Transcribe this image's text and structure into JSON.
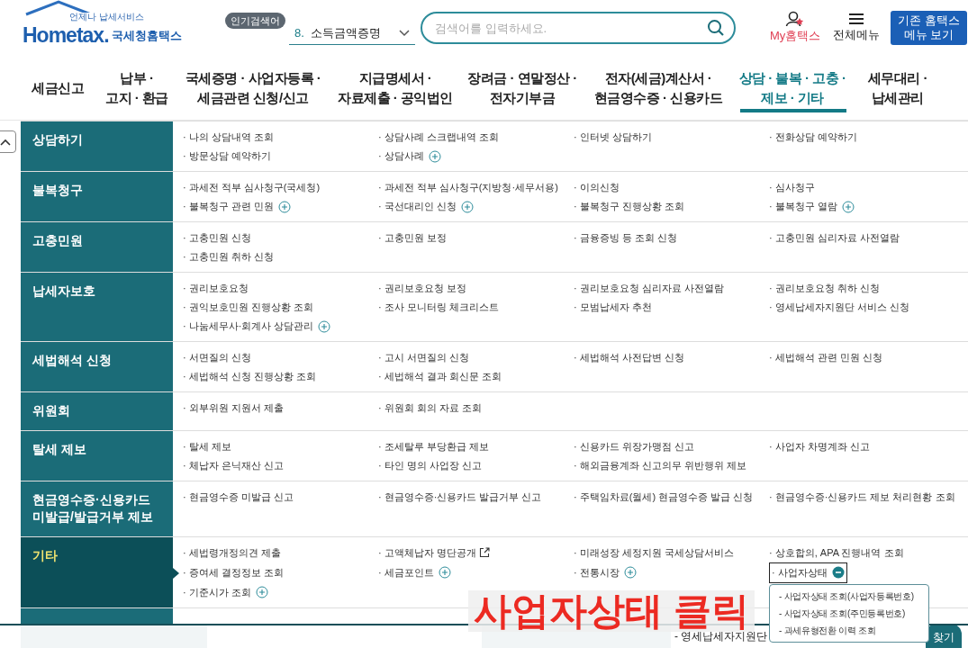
{
  "header": {
    "logo": {
      "tagline": "언제나 납세서비스",
      "wordmark": "Hometax.",
      "title": "국세청홈택스"
    },
    "popular": {
      "badge": "인기검색어",
      "rank": "8.",
      "keyword": "소득금액증명"
    },
    "search": {
      "placeholder": "검색어를 입력하세요."
    },
    "my_hometax": "My홈택스",
    "all_menu": "전체메뉴",
    "legacy_button": "기존 홈택스\n메뉴 보기"
  },
  "nav": [
    {
      "label": "세금신고",
      "selected": false
    },
    {
      "label": "납부 ·\n고지 · 환급",
      "selected": false
    },
    {
      "label": "국세증명 · 사업자등록 ·\n세금관련 신청/신고",
      "selected": false
    },
    {
      "label": "지급명세서 ·\n자료제출 · 공익법인",
      "selected": false
    },
    {
      "label": "장려금 · 연말정산 ·\n전자기부금",
      "selected": false
    },
    {
      "label": "전자(세금)계산서 ·\n현금영수증 · 신용카드",
      "selected": false
    },
    {
      "label": "상담 · 불복 · 고충 ·\n제보 · 기타",
      "selected": true
    },
    {
      "label": "세무대리 ·\n납세관리",
      "selected": false
    }
  ],
  "categories": [
    {
      "title": "상담하기",
      "selected": false,
      "items": [
        {
          "kind": "link",
          "text": "· 나의 상담내역 조회"
        },
        {
          "kind": "link",
          "text": "· 상담사례 스크랩내역 조회"
        },
        {
          "kind": "link",
          "text": "· 인터넷 상담하기"
        },
        {
          "kind": "link",
          "text": "· 전화상담 예약하기"
        },
        {
          "kind": "link",
          "text": "· 방문상담 예약하기"
        },
        {
          "kind": "toggle",
          "text": "· 상담사례",
          "expanded": false
        }
      ]
    },
    {
      "title": "불복청구",
      "selected": false,
      "items": [
        {
          "kind": "link",
          "text": "· 과세전 적부 심사청구(국세청)"
        },
        {
          "kind": "link",
          "text": "· 과세전 적부 심사청구(지방청·세무서용)"
        },
        {
          "kind": "link",
          "text": "· 이의신청"
        },
        {
          "kind": "link",
          "text": "· 심사청구"
        },
        {
          "kind": "toggle",
          "text": "· 불복청구 관련 민원",
          "expanded": false
        },
        {
          "kind": "toggle",
          "text": "· 국선대리인 신청",
          "expanded": false
        },
        {
          "kind": "link",
          "text": "· 불복청구 진행상황 조회"
        },
        {
          "kind": "toggle",
          "text": "· 불복청구 열람",
          "expanded": false
        }
      ]
    },
    {
      "title": "고충민원",
      "selected": false,
      "items": [
        {
          "kind": "link",
          "text": "· 고충민원 신청"
        },
        {
          "kind": "link",
          "text": "· 고충민원 보정"
        },
        {
          "kind": "link",
          "text": "· 금융증빙 등 조회 신청"
        },
        {
          "kind": "link",
          "text": "· 고충민원 심리자료 사전열람"
        },
        {
          "kind": "link",
          "text": "· 고충민원 취하 신청"
        }
      ]
    },
    {
      "title": "납세자보호",
      "selected": false,
      "items": [
        {
          "kind": "link",
          "text": "· 권리보호요청"
        },
        {
          "kind": "link",
          "text": "· 권리보호요청 보정"
        },
        {
          "kind": "link",
          "text": "· 권리보호요청 심리자료 사전열람"
        },
        {
          "kind": "link",
          "text": "· 권리보호요청 취하 신청"
        },
        {
          "kind": "link",
          "text": "· 권익보호민원 진행상황 조회"
        },
        {
          "kind": "link",
          "text": "· 조사 모니터링 체크리스트"
        },
        {
          "kind": "link",
          "text": "· 모범납세자 추천"
        },
        {
          "kind": "link",
          "text": "· 영세납세자지원단 서비스 신청"
        },
        {
          "kind": "toggle",
          "text": "· 나눔세무사·회계사 상담관리",
          "expanded": false
        }
      ]
    },
    {
      "title": "세법해석 신청",
      "selected": false,
      "items": [
        {
          "kind": "link",
          "text": "· 서면질의 신청"
        },
        {
          "kind": "link",
          "text": "· 고시 서면질의 신청"
        },
        {
          "kind": "link",
          "text": "· 세법해석 사전답변 신청"
        },
        {
          "kind": "link",
          "text": "· 세법해석 관련 민원 신청"
        },
        {
          "kind": "link",
          "text": "· 세법해석 신청 진행상황 조회"
        },
        {
          "kind": "link",
          "text": "· 세법해석 결과 회신문 조회"
        }
      ]
    },
    {
      "title": "위원회",
      "selected": false,
      "items": [
        {
          "kind": "link",
          "text": "· 외부위원 지원서 제출"
        },
        {
          "kind": "link",
          "text": "· 위원회 회의 자료 조회"
        }
      ]
    },
    {
      "title": "탈세 제보",
      "selected": false,
      "items": [
        {
          "kind": "link",
          "text": "· 탈세 제보"
        },
        {
          "kind": "link",
          "text": "· 조세탈루 부당환급 제보"
        },
        {
          "kind": "link",
          "text": "· 신용카드 위장가맹점 신고"
        },
        {
          "kind": "link",
          "text": "· 사업자 차명계좌 신고"
        },
        {
          "kind": "link",
          "text": "· 체납자 은닉재산 신고"
        },
        {
          "kind": "link",
          "text": "· 타인 명의 사업장 신고"
        },
        {
          "kind": "link",
          "text": "· 해외금융계좌 신고의무 위반행위 제보"
        }
      ]
    },
    {
      "title": "현금영수증·신용카드\n미발급/발급거부 제보",
      "selected": false,
      "items": [
        {
          "kind": "link",
          "text": "· 현금영수증 미발급 신고"
        },
        {
          "kind": "link",
          "text": "· 현금영수증·신용카드 발급거부 신고"
        },
        {
          "kind": "link",
          "text": "· 주택임차료(월세) 현금영수증 발급 신청"
        },
        {
          "kind": "link",
          "text": "· 현금영수증·신용카드 제보 처리현황 조회"
        }
      ]
    },
    {
      "title": "기타",
      "selected": true,
      "items": [
        {
          "kind": "link",
          "text": "· 세법령개정의견 제출"
        },
        {
          "kind": "external",
          "text": "· 고액체납자 명단공개"
        },
        {
          "kind": "link",
          "text": "· 미래성장 세정지원 국세상담서비스"
        },
        {
          "kind": "link",
          "text": "· 상호합의, APA 진행내역 조회"
        },
        {
          "kind": "link",
          "text": "· 증여세 결정정보 조회"
        },
        {
          "kind": "toggle",
          "text": "· 세금포인트",
          "expanded": false
        },
        {
          "kind": "toggle",
          "text": "· 전통시장",
          "expanded": false
        },
        {
          "kind": "toggle",
          "text": "· 사업자상태",
          "expanded": true,
          "children": [
            "- 사업자상태 조회(사업자등록번호)",
            "- 사업자상태 조회(주민등록번호)",
            "- 과세유형전환 이력 조회"
          ]
        },
        {
          "kind": "toggle",
          "text": "· 기준시가 조회",
          "expanded": false
        }
      ]
    }
  ],
  "annotation": "사업자상태 클릭",
  "background_page": {
    "text": "- 영세납세자지원단",
    "button": "찾기"
  }
}
